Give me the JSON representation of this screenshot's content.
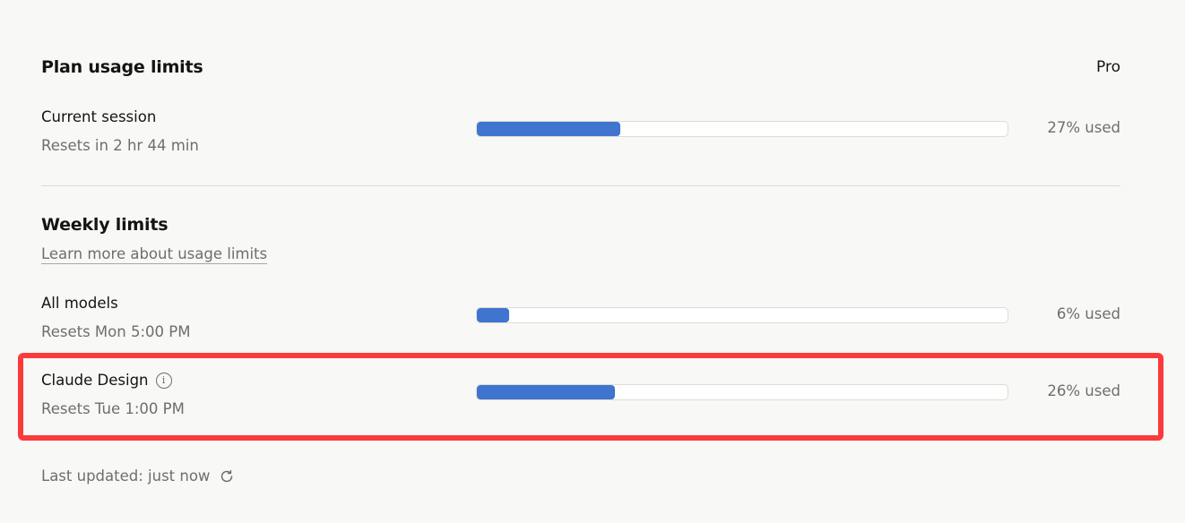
{
  "plan_usage": {
    "title": "Plan usage limits",
    "plan_name": "Pro",
    "current_session": {
      "name": "Current session",
      "reset_text": "Resets in 2 hr 44 min",
      "percent_used": 27,
      "percent_label": "27% used"
    }
  },
  "weekly": {
    "title": "Weekly limits",
    "learn_more_label": "Learn more about usage limits",
    "items": [
      {
        "name": "All models",
        "reset_text": "Resets Mon 5:00 PM",
        "percent_used": 6,
        "percent_label": "6% used"
      },
      {
        "name": "Claude Design",
        "reset_text": "Resets Tue 1:00 PM",
        "percent_used": 26,
        "percent_label": "26% used",
        "info_icon": "info-icon",
        "highlighted": true
      }
    ]
  },
  "footer": {
    "last_updated": "Last updated: just now",
    "refresh_icon": "refresh-icon"
  },
  "colors": {
    "bar_fill": "#3f74cf",
    "highlight_border": "#fb3b3b",
    "background": "#f8f8f6"
  }
}
